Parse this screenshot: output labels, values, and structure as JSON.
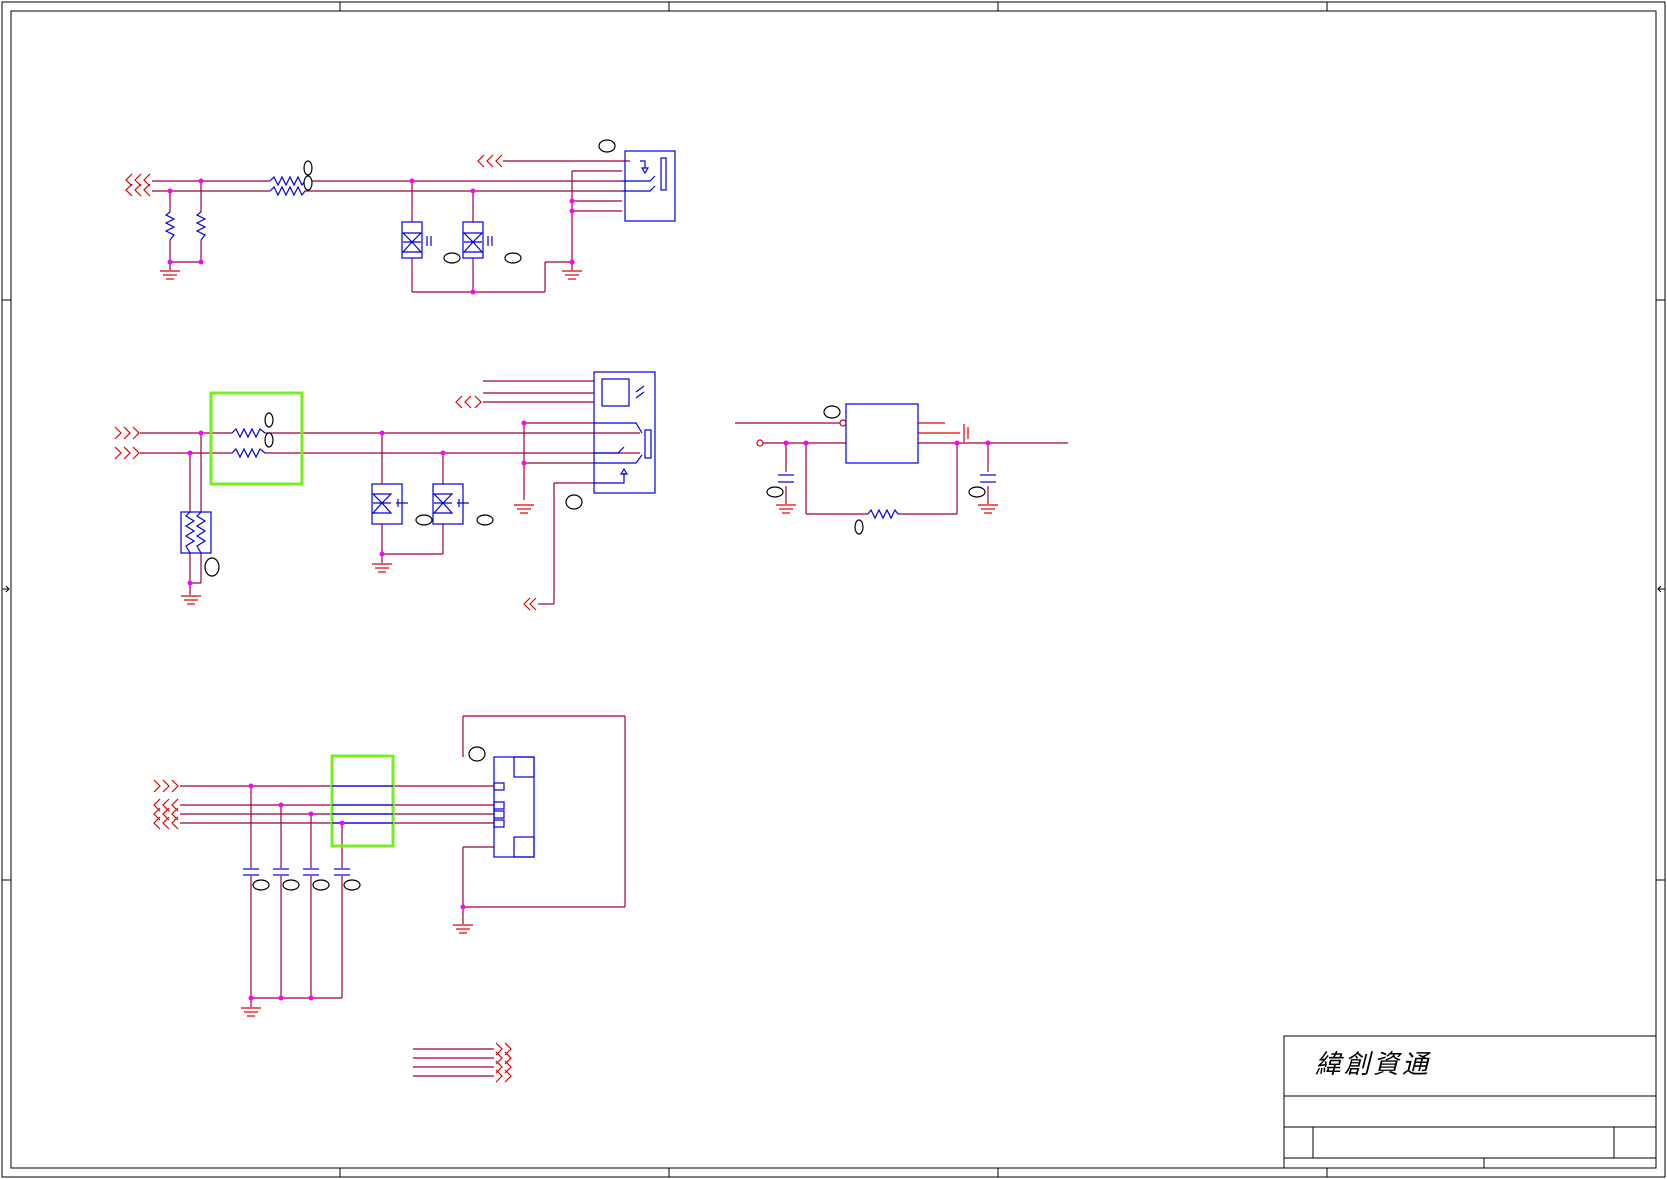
{
  "title_block": {
    "company_name": "緯創資通"
  },
  "colors": {
    "wire": "#a0003c",
    "power_wire": "#e00000",
    "symbol": "#0000e0",
    "junction": "#ff00ff",
    "highlight": "#77ee22",
    "border": "#000000",
    "tag": "#000000"
  },
  "icons": {
    "ground": "ground-symbol-icon",
    "port": "chevron-port-icon",
    "resistor": "zigzag-resistor-icon",
    "capacitor": "capacitor-icon",
    "tvs": "tvs-diode-icon",
    "connector": "connector-box-icon"
  }
}
